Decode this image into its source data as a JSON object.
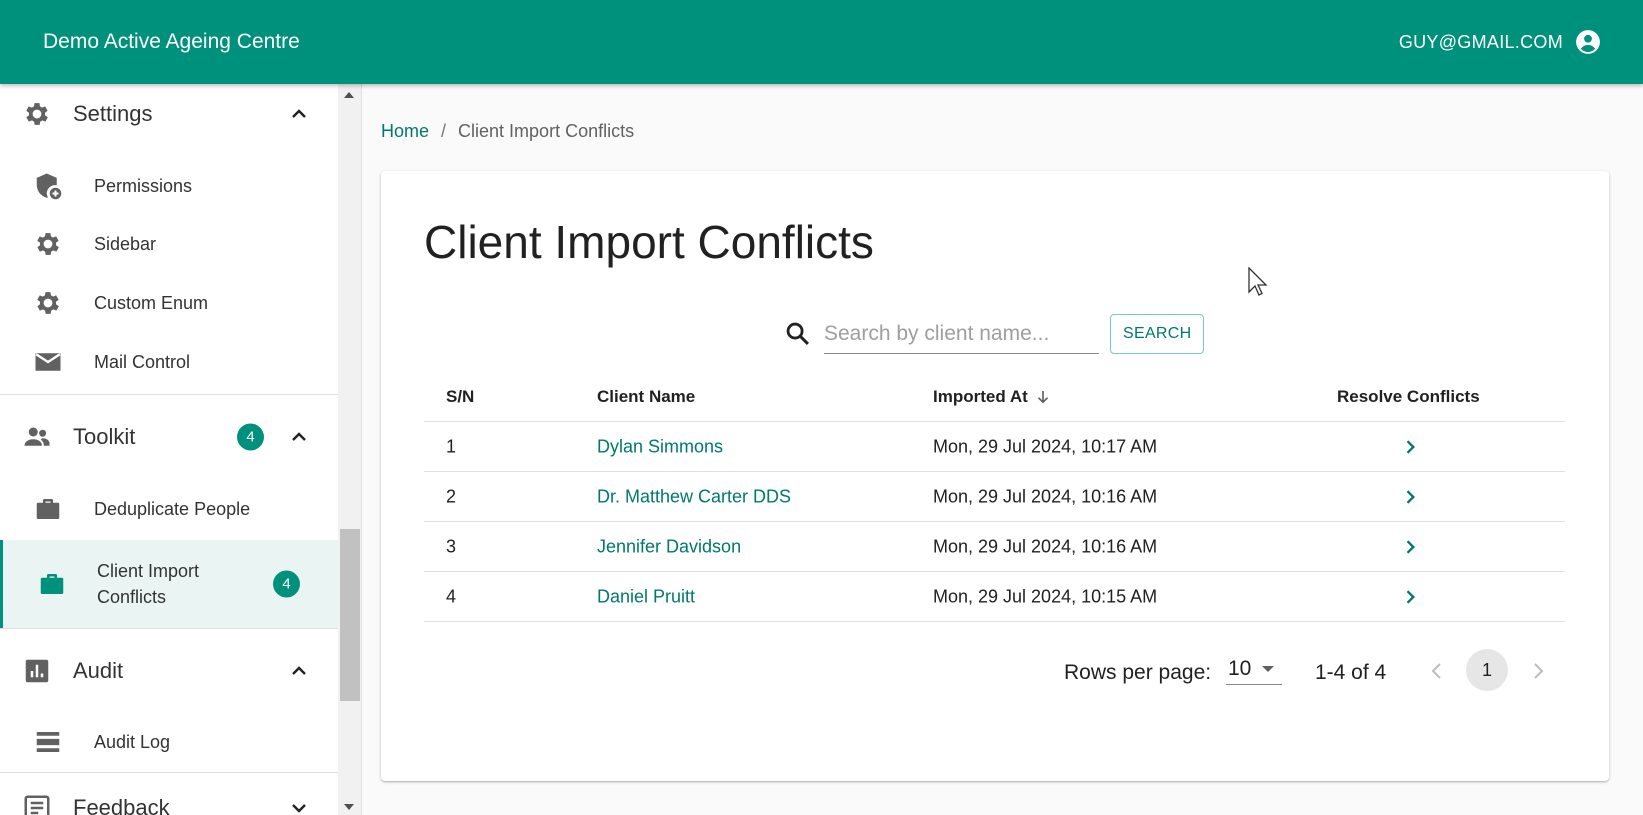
{
  "app": {
    "title": "Demo Active Ageing Centre",
    "user_email": "GUY@GMAIL.COM"
  },
  "sidebar": {
    "groups": [
      {
        "label": "Settings",
        "icon": "gear-icon",
        "expanded": true,
        "items": [
          {
            "label": "Permissions",
            "icon": "admin-shield-icon"
          },
          {
            "label": "Sidebar",
            "icon": "gear-icon"
          },
          {
            "label": "Custom Enum",
            "icon": "gear-icon"
          },
          {
            "label": "Mail Control",
            "icon": "mail-icon"
          }
        ]
      },
      {
        "label": "Toolkit",
        "icon": "people-icon",
        "badge": "4",
        "expanded": true,
        "items": [
          {
            "label": "Deduplicate People",
            "icon": "briefcase-icon"
          },
          {
            "label": "Client Import Conflicts",
            "icon": "briefcase-icon",
            "badge": "4",
            "active": true
          }
        ]
      },
      {
        "label": "Audit",
        "icon": "bar-chart-icon",
        "expanded": true,
        "items": [
          {
            "label": "Audit Log",
            "icon": "list-icon"
          }
        ]
      },
      {
        "label": "Feedback",
        "icon": "feedback-icon",
        "expanded": false
      }
    ]
  },
  "breadcrumb": {
    "home": "Home",
    "separator": "/",
    "current": "Client Import Conflicts"
  },
  "page": {
    "title": "Client Import Conflicts"
  },
  "search": {
    "placeholder": "Search by client name...",
    "value": "",
    "button_label": "SEARCH"
  },
  "table": {
    "headers": {
      "sn": "S/N",
      "name": "Client Name",
      "imported_at": "Imported At",
      "resolve": "Resolve Conflicts"
    },
    "rows": [
      {
        "sn": "1",
        "name": "Dylan Simmons",
        "imported_at": "Mon, 29 Jul 2024, 10:17 AM"
      },
      {
        "sn": "2",
        "name": "Dr. Matthew Carter DDS",
        "imported_at": "Mon, 29 Jul 2024, 10:16 AM"
      },
      {
        "sn": "3",
        "name": "Jennifer Davidson",
        "imported_at": "Mon, 29 Jul 2024, 10:16 AM"
      },
      {
        "sn": "4",
        "name": "Daniel Pruitt",
        "imported_at": "Mon, 29 Jul 2024, 10:15 AM"
      }
    ]
  },
  "pagination": {
    "rows_per_page_label": "Rows per page:",
    "rows_per_page": "10",
    "range": "1-4 of 4",
    "current_page": "1"
  },
  "colors": {
    "primary": "#00917c",
    "link": "#00796b",
    "active_bg": "#eaf5f3"
  }
}
